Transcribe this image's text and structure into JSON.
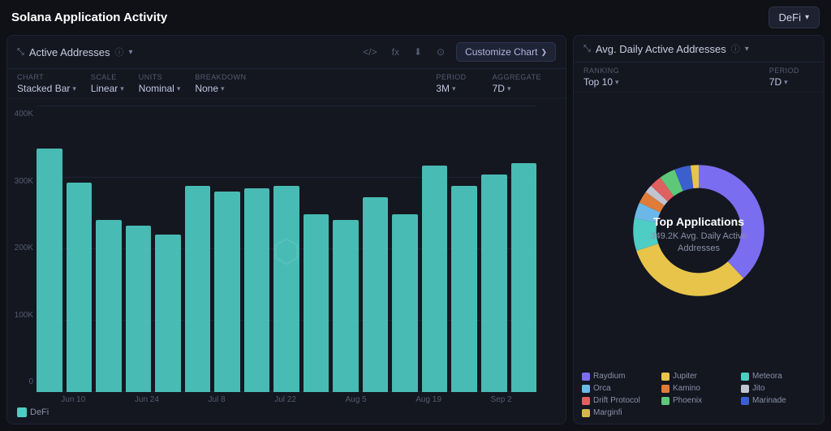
{
  "app": {
    "title": "Solana Application Activity",
    "defi_label": "DeFi"
  },
  "left_panel": {
    "header": {
      "icon": "📈",
      "title": "Active Addresses",
      "info_icon": "ⓘ",
      "actions": {
        "code_icon": "</>",
        "formula_icon": "fx",
        "download_icon": "⬇",
        "camera_icon": "📷",
        "customize_label": "Customize Chart"
      }
    },
    "controls": {
      "chart": {
        "label": "CHART",
        "value": "Stacked Bar"
      },
      "scale": {
        "label": "SCALE",
        "value": "Linear"
      },
      "units": {
        "label": "UNITS",
        "value": "Nominal"
      },
      "breakdown": {
        "label": "BREAKDOWN",
        "value": "None"
      },
      "period": {
        "label": "PERIOD",
        "value": "3M"
      },
      "aggregate": {
        "label": "AGGREGATE",
        "value": "7D"
      }
    },
    "y_labels": [
      "0",
      "100K",
      "200K",
      "300K",
      "400K"
    ],
    "x_labels": [
      "Jun 10",
      "Jun 24",
      "Jul 8",
      "Jul 22",
      "Aug 5",
      "Aug 19",
      "Sep 2"
    ],
    "bars": [
      {
        "height_pct": 85,
        "label": "Jun 10"
      },
      {
        "height_pct": 73,
        "label": ""
      },
      {
        "height_pct": 60,
        "label": "Jun 24"
      },
      {
        "height_pct": 58,
        "label": ""
      },
      {
        "height_pct": 55,
        "label": "Jul 8"
      },
      {
        "height_pct": 72,
        "label": ""
      },
      {
        "height_pct": 70,
        "label": "Jul 22"
      },
      {
        "height_pct": 71,
        "label": ""
      },
      {
        "height_pct": 72,
        "label": ""
      },
      {
        "height_pct": 62,
        "label": "Aug 5"
      },
      {
        "height_pct": 60,
        "label": ""
      },
      {
        "height_pct": 68,
        "label": "Aug 19"
      },
      {
        "height_pct": 62,
        "label": ""
      },
      {
        "height_pct": 79,
        "label": ""
      },
      {
        "height_pct": 72,
        "label": "Sep 2"
      },
      {
        "height_pct": 76,
        "label": ""
      },
      {
        "height_pct": 80,
        "label": ""
      }
    ],
    "legend": [
      {
        "color": "#4ecdc4",
        "label": "DeFi"
      }
    ]
  },
  "right_panel": {
    "header": {
      "icon": "📈",
      "title": "Avg. Daily Active Addresses",
      "info_icon": "ⓘ"
    },
    "controls": {
      "ranking": {
        "label": "RANKING",
        "value": "Top 10"
      },
      "period": {
        "label": "PERIOD",
        "value": "7D"
      }
    },
    "donut": {
      "title": "Top Applications",
      "subtitle": "349.2K Avg. Daily Active\nAddresses",
      "segments": [
        {
          "color": "#7b6df0",
          "pct": 38,
          "label": "Raydium"
        },
        {
          "color": "#e8c44a",
          "pct": 32,
          "label": "Jupiter"
        },
        {
          "color": "#4ecdc4",
          "pct": 8,
          "label": "Meteora"
        },
        {
          "color": "#6bb8e8",
          "pct": 4,
          "label": "Orca"
        },
        {
          "color": "#e07b39",
          "pct": 3,
          "label": "Kamino"
        },
        {
          "color": "#c0c4d0",
          "pct": 2,
          "label": "Jito"
        },
        {
          "color": "#e06060",
          "pct": 3,
          "label": "Drift Protocol"
        },
        {
          "color": "#5ec87a",
          "pct": 4,
          "label": "Phoenix"
        },
        {
          "color": "#3b5fcf",
          "pct": 4,
          "label": "Marinade"
        },
        {
          "color": "#e8c44a",
          "pct": 2,
          "label": "Marginfi"
        }
      ]
    },
    "legend_items": [
      {
        "color": "#7b6df0",
        "label": "Raydium"
      },
      {
        "color": "#e8c44a",
        "label": "Jupiter"
      },
      {
        "color": "#4ecdc4",
        "label": "Meteora"
      },
      {
        "color": "#6bb8e8",
        "label": "Orca"
      },
      {
        "color": "#e07b39",
        "label": "Kamino"
      },
      {
        "color": "#c0c4d0",
        "label": "Jito"
      },
      {
        "color": "#e06060",
        "label": "Drift Protocol"
      },
      {
        "color": "#5ec87a",
        "label": "Phoenix"
      },
      {
        "color": "#3b5fcf",
        "label": "Marinade"
      },
      {
        "color": "#d4b84a",
        "label": "Marginfi"
      }
    ]
  }
}
